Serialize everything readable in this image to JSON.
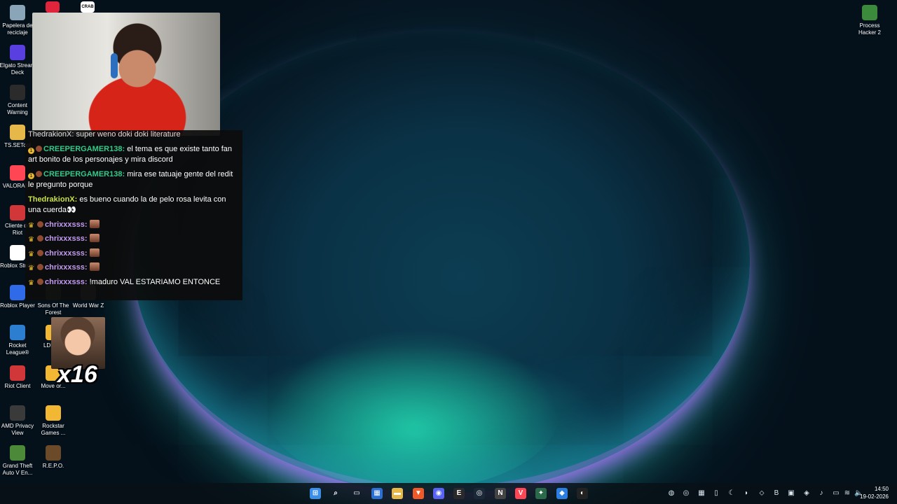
{
  "desktop_icons_left": [
    {
      "label": "Papelera de reciclaje",
      "icon": "recycle-bin-icon",
      "color": "#8aa4b8"
    },
    {
      "label": "Elgato Stream Deck",
      "icon": "stream-deck-icon",
      "color": "#5a3fe0"
    },
    {
      "label": "Content Warning",
      "icon": "content-warning-icon",
      "color": "#2b2b2b"
    },
    {
      "label": "TS.SETool",
      "icon": "folder-icon",
      "color": "#e6b84a"
    },
    {
      "label": "VALORANT",
      "icon": "valorant-icon",
      "color": "#ff4655"
    },
    {
      "label": "Cliente de Riot",
      "icon": "riot-icon",
      "color": "#d13639"
    },
    {
      "label": "Roblox Studio",
      "icon": "roblox-studio-icon",
      "color": "#ffffff"
    },
    {
      "label": "Roblox Player",
      "icon": "roblox-icon",
      "color": "#2f6be8"
    },
    {
      "label": "Rocket League®",
      "icon": "rocket-league-icon",
      "color": "#2c7fd0"
    },
    {
      "label": "Riot Client",
      "icon": "riot-client-icon",
      "color": "#d13639"
    },
    {
      "label": "AMD Privacy View",
      "icon": "amd-privacy-icon",
      "color": "#3a3a3a"
    },
    {
      "label": "Grand Theft Auto V En...",
      "icon": "gta-v-icon",
      "color": "#4c8a3a"
    }
  ],
  "desktop_icons_second_col": [
    {
      "label": "Sons Of The Forest",
      "icon": "sons-of-the-forest-icon",
      "color": "#3a5a3a"
    },
    {
      "label": "LDMu...",
      "icon": "ldmulti-icon",
      "color": "#f2b733"
    },
    {
      "label": "Move or...",
      "icon": "move-or-die-icon",
      "color": "#f2b733"
    },
    {
      "label": "Rockstar Games ...",
      "icon": "rockstar-icon",
      "color": "#f2b733"
    },
    {
      "label": "R.E.P.O.",
      "icon": "repo-icon",
      "color": "#6b4a2a"
    }
  ],
  "desktop_icons_third_col": [
    {
      "label": "World War Z",
      "icon": "world-war-z-icon",
      "color": "#5a5a5a"
    }
  ],
  "desktop_icons_right": [
    {
      "label": "Process Hacker 2",
      "icon": "process-hacker-icon",
      "color": "#3c8a3c"
    }
  ],
  "top_partial_icons": [
    {
      "icon": "tiktok-icon",
      "color": "#e0243c"
    },
    {
      "icon": "crab-game-icon",
      "color": "#ffffff",
      "label": "CRAB"
    }
  ],
  "chat": {
    "partial_top": "ThedrakionX: super weno doki doki literature",
    "messages": [
      {
        "badges": [
          "one",
          "tb"
        ],
        "user": "CREEPERGAMER138",
        "user_color": "#35c98a",
        "text": "el tema es que existe tanto fan art bonito de los personajes y mira discord"
      },
      {
        "badges": [
          "one",
          "tb"
        ],
        "user": "CREEPERGAMER138",
        "user_color": "#35c98a",
        "text": "mira ese tatuaje gente del redit le pregunto porque"
      },
      {
        "badges": [],
        "user": "ThedrakionX",
        "user_color": "#c8e04a",
        "text": "es bueno cuando la de pelo rosa levita con una cuerda👀"
      },
      {
        "badges": [
          "crown",
          "tb"
        ],
        "user": "chrixxxsss",
        "user_color": "#c49bf0",
        "text": "",
        "emote": true
      },
      {
        "badges": [
          "crown",
          "tb"
        ],
        "user": "chrixxxsss",
        "user_color": "#c49bf0",
        "text": "",
        "emote": true
      },
      {
        "badges": [
          "crown",
          "tb"
        ],
        "user": "chrixxxsss",
        "user_color": "#c49bf0",
        "text": "",
        "emote": true
      },
      {
        "badges": [
          "crown",
          "tb"
        ],
        "user": "chrixxxsss",
        "user_color": "#c49bf0",
        "text": "",
        "emote": true
      },
      {
        "badges": [
          "crown",
          "tb"
        ],
        "user": "chrixxxsss",
        "user_color": "#c49bf0",
        "text": "!maduro VAL ESTARIAMO ENTONCE"
      }
    ]
  },
  "emote_combo": {
    "count": "x16"
  },
  "taskbar": {
    "apps": [
      {
        "name": "start-button",
        "glyph": "⊞",
        "color": "#3a8ee6"
      },
      {
        "name": "search-icon",
        "glyph": "⌕",
        "color": "transparent"
      },
      {
        "name": "task-view-icon",
        "glyph": "▭",
        "color": "transparent"
      },
      {
        "name": "store-icon",
        "glyph": "▦",
        "color": "#2b6fd0"
      },
      {
        "name": "file-explorer-icon",
        "glyph": "▬",
        "color": "#e6b84a"
      },
      {
        "name": "brave-icon",
        "glyph": "▼",
        "color": "#f05a28"
      },
      {
        "name": "discord-icon",
        "glyph": "◉",
        "color": "#5865f2"
      },
      {
        "name": "epic-games-icon",
        "glyph": "E",
        "color": "#2a2a2a"
      },
      {
        "name": "steam-icon",
        "glyph": "◎",
        "color": "#1b2838"
      },
      {
        "name": "notion-icon",
        "glyph": "N",
        "color": "#444444"
      },
      {
        "name": "valorant-icon",
        "glyph": "V",
        "color": "#ff4655"
      },
      {
        "name": "app-icon",
        "glyph": "✦",
        "color": "#2a6a4a"
      },
      {
        "name": "app-icon-blue",
        "glyph": "◆",
        "color": "#2b7fe0"
      },
      {
        "name": "obs-icon",
        "glyph": "◐",
        "color": "#222222"
      }
    ],
    "tray": [
      {
        "name": "tray-app-1",
        "glyph": "◍"
      },
      {
        "name": "tray-steam",
        "glyph": "◎"
      },
      {
        "name": "tray-app-3",
        "glyph": "▦"
      },
      {
        "name": "tray-app-4",
        "glyph": "▯"
      },
      {
        "name": "tray-app-5",
        "glyph": "☾"
      },
      {
        "name": "tray-app-6",
        "glyph": "◗"
      },
      {
        "name": "tray-app-7",
        "glyph": "⬦"
      },
      {
        "name": "tray-app-8",
        "glyph": "B"
      },
      {
        "name": "tray-app-9",
        "glyph": "▣"
      },
      {
        "name": "tray-app-10",
        "glyph": "◈"
      },
      {
        "name": "tray-mic",
        "glyph": "♪"
      },
      {
        "name": "tray-network",
        "glyph": "▭"
      },
      {
        "name": "tray-wifi",
        "glyph": "≋"
      },
      {
        "name": "tray-volume",
        "glyph": "🔈"
      }
    ],
    "clock_time": "14:50",
    "clock_date": "19-02-2026"
  }
}
